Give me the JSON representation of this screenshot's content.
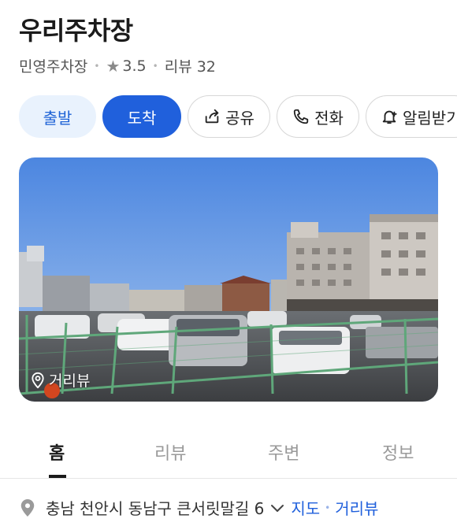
{
  "place": {
    "name": "우리주차장",
    "category": "민영주차장",
    "rating": "3.5",
    "review_label": "리뷰 32"
  },
  "actions": {
    "depart": "출발",
    "arrive": "도착",
    "share": "공유",
    "call": "전화",
    "alarm": "알림받기"
  },
  "photo": {
    "streetview_label": "거리뷰"
  },
  "tabs": [
    "홈",
    "리뷰",
    "주변",
    "정보"
  ],
  "address": {
    "text": "충남 천안시 동남구 큰서릿말길 6",
    "map_link": "지도",
    "streetview_link": "거리뷰"
  },
  "colors": {
    "accent": "#2060dc",
    "accent_light": "#e9f2fd"
  },
  "icons": [
    "star-icon",
    "share-icon",
    "phone-icon",
    "bell-icon",
    "location-pin-icon",
    "chevron-down-icon",
    "map-pin-icon"
  ]
}
